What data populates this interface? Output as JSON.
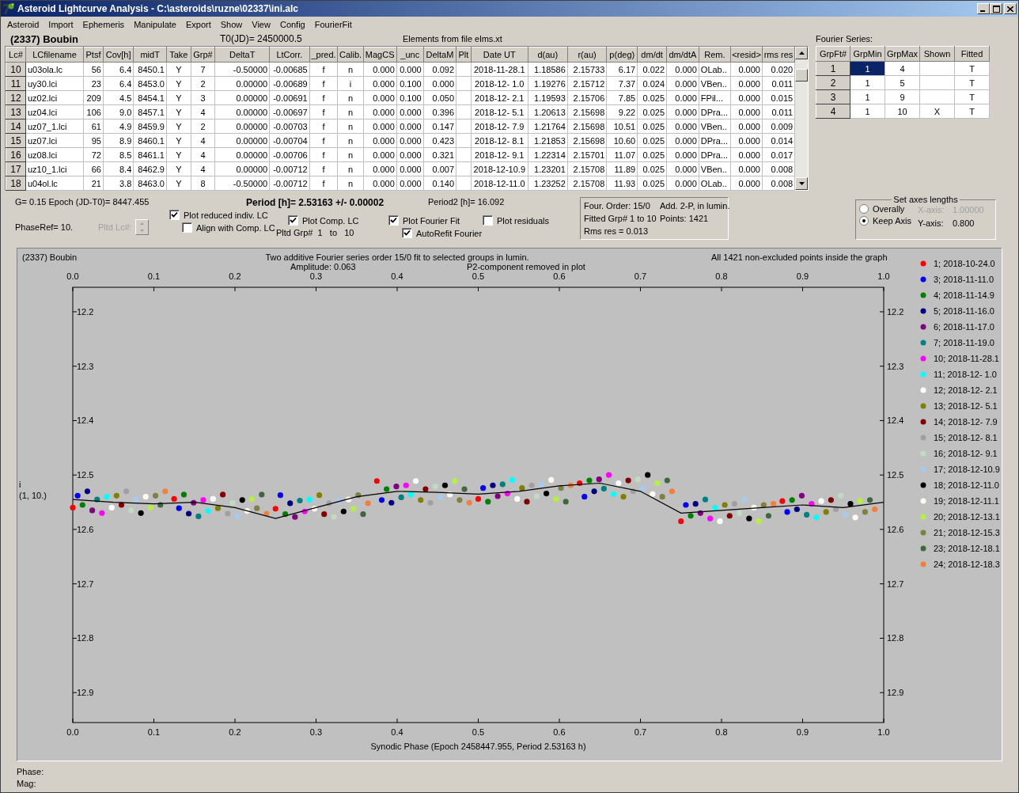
{
  "window": {
    "title": "Asteroid Lightcurve Analysis - C:\\asteroids\\ruzne\\02337\\ini.alc"
  },
  "menu": [
    "Asteroid",
    "Import",
    "Ephemeris",
    "Manipulate",
    "Export",
    "Show",
    "View",
    "Config",
    "FourierFit"
  ],
  "header": {
    "asteroid": "(2337) Boubin",
    "t0": "T0(JD)= 2450000.5",
    "elements": "Elements from file elms.xt"
  },
  "table": {
    "columns": [
      "Lc#",
      "LCfilename",
      "Ptsf",
      "Cov[h]",
      "midT",
      "Take",
      "Grp#",
      "DeltaT",
      "LtCorr.",
      "_pred.",
      "Calib.",
      "MagCS",
      "_unc",
      "DeltaM",
      "Plt",
      "Date UT",
      "d(au)",
      "r(au)",
      "p(deg)",
      "dm/dt",
      "dm/dtA",
      "Rem.",
      "<resid>",
      "rms res"
    ],
    "rows": [
      {
        "cells": [
          "10",
          "u03ola.lc",
          "56",
          "6.4",
          "8450.1",
          "Y",
          "7",
          "-0.50000",
          "-0.00685",
          "f",
          "n",
          "0.000",
          "0.000",
          "0.092",
          "",
          "2018-11-28.1",
          "1.18586",
          "2.15733",
          "6.17",
          "0.022",
          "0.000",
          "OLab..",
          "0.000",
          "0.020"
        ]
      },
      {
        "cells": [
          "11",
          "uy30.lci",
          "23",
          "6.4",
          "8453.0",
          "Y",
          "2",
          "0.00000",
          "-0.00689",
          "f",
          "i",
          "0.000",
          "0.100",
          "0.000",
          "",
          "2018-12- 1.0",
          "1.19276",
          "2.15712",
          "7.37",
          "0.024",
          "0.000",
          "VBen..",
          "0.000",
          "0.011"
        ]
      },
      {
        "cells": [
          "12",
          "uz02.lci",
          "209",
          "4.5",
          "8454.1",
          "Y",
          "3",
          "0.00000",
          "-0.00691",
          "f",
          "n",
          "0.000",
          "0.100",
          "0.050",
          "",
          "2018-12- 2.1",
          "1.19593",
          "2.15706",
          "7.85",
          "0.025",
          "0.000",
          "FPil...",
          "0.000",
          "0.015"
        ]
      },
      {
        "cells": [
          "13",
          "uz04.lci",
          "106",
          "9.0",
          "8457.1",
          "Y",
          "4",
          "0.00000",
          "-0.00697",
          "f",
          "n",
          "0.000",
          "0.000",
          "0.396",
          "",
          "2018-12- 5.1",
          "1.20613",
          "2.15698",
          "9.22",
          "0.025",
          "0.000",
          "DPra...",
          "0.000",
          "0.011"
        ]
      },
      {
        "cells": [
          "14",
          "uz07_1.lci",
          "61",
          "4.9",
          "8459.9",
          "Y",
          "2",
          "0.00000",
          "-0.00703",
          "f",
          "n",
          "0.000",
          "0.000",
          "0.147",
          "",
          "2018-12- 7.9",
          "1.21764",
          "2.15698",
          "10.51",
          "0.025",
          "0.000",
          "VBen..",
          "0.000",
          "0.009"
        ]
      },
      {
        "cells": [
          "15",
          "uz07.lci",
          "95",
          "8.9",
          "8460.1",
          "Y",
          "4",
          "0.00000",
          "-0.00704",
          "f",
          "n",
          "0.000",
          "0.000",
          "0.423",
          "",
          "2018-12- 8.1",
          "1.21853",
          "2.15698",
          "10.60",
          "0.025",
          "0.000",
          "DPra...",
          "0.000",
          "0.014"
        ]
      },
      {
        "cells": [
          "16",
          "uz08.lci",
          "72",
          "8.5",
          "8461.1",
          "Y",
          "4",
          "0.00000",
          "-0.00706",
          "f",
          "n",
          "0.000",
          "0.000",
          "0.321",
          "",
          "2018-12- 9.1",
          "1.22314",
          "2.15701",
          "11.07",
          "0.025",
          "0.000",
          "DPra...",
          "0.000",
          "0.017"
        ]
      },
      {
        "cells": [
          "17",
          "uz10_1.lci",
          "66",
          "8.4",
          "8462.9",
          "Y",
          "4",
          "0.00000",
          "-0.00712",
          "f",
          "n",
          "0.000",
          "0.000",
          "0.007",
          "",
          "2018-12-10.9",
          "1.23201",
          "2.15708",
          "11.89",
          "0.025",
          "0.000",
          "VBen..",
          "0.000",
          "0.008"
        ]
      },
      {
        "cells": [
          "18",
          "u04ol.lc",
          "21",
          "3.8",
          "8463.0",
          "Y",
          "8",
          "-0.50000",
          "-0.00712",
          "f",
          "n",
          "0.000",
          "0.000",
          "0.140",
          "",
          "2018-12-11.0",
          "1.23252",
          "2.15708",
          "11.93",
          "0.025",
          "0.000",
          "OLab..",
          "0.000",
          "0.008"
        ]
      }
    ]
  },
  "fourier_series": {
    "label": "Fourier Series:",
    "columns": [
      "GrpFt#",
      "GrpMin",
      "GrpMax",
      "Shown",
      "Fitted"
    ],
    "rows": [
      {
        "cells": [
          {
            "text": "1"
          },
          {
            "text": "1",
            "selected": true
          },
          {
            "text": "4",
            "selected": false
          },
          {
            "text": "",
            "selected": false
          },
          {
            "text": "T",
            "selected": false
          }
        ]
      },
      {
        "cells": [
          {
            "text": "2"
          },
          {
            "text": "1",
            "selected": false
          },
          {
            "text": "5",
            "selected": false
          },
          {
            "text": "",
            "selected": false
          },
          {
            "text": "T",
            "selected": false
          }
        ]
      },
      {
        "cells": [
          {
            "text": "3"
          },
          {
            "text": "1",
            "selected": false
          },
          {
            "text": "9",
            "selected": false
          },
          {
            "text": "",
            "selected": false
          },
          {
            "text": "T",
            "selected": false
          }
        ]
      },
      {
        "cells": [
          {
            "text": "4"
          },
          {
            "text": "1",
            "selected": false
          },
          {
            "text": "10",
            "selected": false
          },
          {
            "text": "X",
            "selected": false
          },
          {
            "text": "T",
            "selected": false
          }
        ]
      }
    ]
  },
  "info": {
    "g_epoch": "G= 0.15   Epoch (JD-T0)= 8447.455",
    "period": "Period [h]= 2.53163 +/- 0.00002",
    "period2": "Period2 [h]= 16.092",
    "phase_ref": "PhaseRef= 10.",
    "pltd_lc": "Pltd Lc#:",
    "pltd_grp": "Pltd Grp#  1   to   10"
  },
  "checkboxes": [
    {
      "label": "Plot reduced indiv. LC",
      "checked": true
    },
    {
      "label": "Align with Comp. LC",
      "checked": false
    },
    {
      "label": "Plot Comp. LC",
      "checked": true
    },
    {
      "label": "Plot Fourier Fit",
      "checked": true
    },
    {
      "label": "AutoRefit Fourier",
      "checked": true
    },
    {
      "label": "Plot residuals",
      "checked": false
    }
  ],
  "fit_summary": [
    "Four. Order: 15/0",
    "Add. 2-P, in lumin.",
    "Fitted Grp# 1 to 10",
    "Points: 1421",
    "Rms res     = 0.013"
  ],
  "axes_lengths": {
    "title": "Set axes lengths",
    "options": [
      {
        "label": "Overally",
        "selected": false
      },
      {
        "label": "Keep Axis",
        "selected": true
      }
    ],
    "x_label": "X-axis:",
    "x_value": "1.00000",
    "x_disabled": true,
    "y_label": "Y-axis:",
    "y_value": "0.800",
    "y_disabled": false
  },
  "chart": {
    "object": "(2337) Boubin",
    "title": "Two additive Fourier series order 15/0 fit to selected groups in lumin.",
    "amplitude": "Amplitude: 0.063",
    "p2_note": "P2-component removed in plot",
    "points_note": "All 1421 non-excluded points inside the graph",
    "ylabel_lines": [
      "i",
      "(1, 10.)"
    ],
    "right_ticks": [
      "12.2",
      "12.3",
      "12.4",
      "12.5",
      "12.6",
      "12.7",
      "12.8",
      "12.9"
    ],
    "chart_data": {
      "type": "scatter",
      "legend": "right",
      "xlabel": "Synodic Phase (Epoch 2458447.955, Period 2.53163 h)",
      "series": [
        {
          "type": "line",
          "color": "#000000",
          "x": [
            0,
            0.05,
            0.1,
            0.15,
            0.2,
            0.25,
            0.3,
            0.35,
            0.4,
            0.45,
            0.5,
            0.55,
            0.6,
            0.65,
            0.7,
            0.75,
            0.8,
            0.85,
            0.9,
            0.95,
            1
          ],
          "values": [
            12.545,
            12.55,
            12.553,
            12.55,
            12.56,
            12.58,
            12.56,
            12.54,
            12.53,
            12.532,
            12.535,
            12.53,
            12.52,
            12.515,
            12.53,
            12.57,
            12.565,
            12.56,
            12.555,
            12.56,
            12.55
          ]
        },
        {
          "name": "1; 2018-10-24.0",
          "color": "#ff0000",
          "x": [
            0,
            0.125,
            0.25,
            0.375,
            0.5,
            0.625,
            0.75,
            0.875
          ],
          "values": [
            12.56,
            12.544,
            12.562,
            12.511,
            12.544,
            12.515,
            12.585,
            12.548
          ]
        },
        {
          "name": "3; 2018-11-11.0",
          "color": "#0000ff",
          "x": [
            0.006,
            0.131,
            0.256,
            0.381,
            0.506,
            0.631,
            0.756,
            0.881
          ],
          "values": [
            12.538,
            12.561,
            12.537,
            12.546,
            12.524,
            12.54,
            12.555,
            12.568
          ]
        },
        {
          "name": "4; 2018-11-14.9",
          "color": "#008000",
          "x": [
            0.012,
            0.137,
            0.262,
            0.387,
            0.512,
            0.637,
            0.762,
            0.887
          ],
          "values": [
            12.555,
            12.536,
            12.572,
            12.526,
            12.549,
            12.51,
            12.575,
            12.546
          ]
        },
        {
          "name": "5; 2018-11-16.0",
          "color": "#000080",
          "x": [
            0.018,
            0.143,
            0.268,
            0.393,
            0.518,
            0.643,
            0.768,
            0.893
          ],
          "values": [
            12.53,
            12.571,
            12.552,
            12.551,
            12.519,
            12.53,
            12.553,
            12.563
          ]
        },
        {
          "name": "6; 2018-11-17.0",
          "color": "#800080",
          "x": [
            0.024,
            0.149,
            0.274,
            0.399,
            0.524,
            0.649,
            0.774,
            0.899
          ],
          "values": [
            12.565,
            12.551,
            12.577,
            12.521,
            12.539,
            12.508,
            12.57,
            12.538
          ]
        },
        {
          "name": "7; 2018-11-19.0",
          "color": "#008080",
          "x": [
            0.03,
            0.155,
            0.28,
            0.405,
            0.53,
            0.655,
            0.78,
            0.905
          ],
          "values": [
            12.545,
            12.576,
            12.547,
            12.541,
            12.517,
            12.525,
            12.545,
            12.573
          ]
        },
        {
          "name": "10; 2018-11-28.1",
          "color": "#ff00ff",
          "x": [
            0.036,
            0.161,
            0.286,
            0.411,
            0.536,
            0.661,
            0.786,
            0.911
          ],
          "values": [
            12.57,
            12.546,
            12.567,
            12.519,
            12.534,
            12.5,
            12.58,
            12.553
          ]
        },
        {
          "name": "11; 2018-12- 1.0",
          "color": "#00ffff",
          "x": [
            0.042,
            0.167,
            0.292,
            0.417,
            0.542,
            0.667,
            0.792,
            0.917
          ],
          "values": [
            12.54,
            12.566,
            12.545,
            12.536,
            12.509,
            12.535,
            12.56,
            12.578
          ]
        },
        {
          "name": "12; 2018-12- 2.1",
          "color": "#ffffff",
          "x": [
            0.048,
            0.173,
            0.298,
            0.423,
            0.548,
            0.673,
            0.798,
            0.923
          ],
          "values": [
            12.56,
            12.544,
            12.562,
            12.511,
            12.544,
            12.515,
            12.585,
            12.548
          ]
        },
        {
          "name": "13; 2018-12- 5.1",
          "color": "#808000",
          "x": [
            0.054,
            0.179,
            0.304,
            0.429,
            0.554,
            0.679,
            0.804,
            0.929
          ],
          "values": [
            12.538,
            12.561,
            12.537,
            12.546,
            12.524,
            12.54,
            12.555,
            12.568
          ]
        },
        {
          "name": "14; 2018-12- 7.9",
          "color": "#800000",
          "x": [
            0.06,
            0.185,
            0.31,
            0.435,
            0.56,
            0.685,
            0.81,
            0.935
          ],
          "values": [
            12.555,
            12.536,
            12.572,
            12.526,
            12.549,
            12.51,
            12.575,
            12.546
          ]
        },
        {
          "name": "15; 2018-12- 8.1",
          "color": "#a0a0a4",
          "x": [
            0.066,
            0.191,
            0.316,
            0.441,
            0.566,
            0.691,
            0.816,
            0.941
          ],
          "values": [
            12.53,
            12.571,
            12.552,
            12.551,
            12.519,
            12.53,
            12.553,
            12.563
          ]
        },
        {
          "name": "16; 2018-12- 9.1",
          "color": "#c0dcc0",
          "x": [
            0.072,
            0.197,
            0.322,
            0.447,
            0.572,
            0.697,
            0.822,
            0.947
          ],
          "values": [
            12.565,
            12.551,
            12.577,
            12.521,
            12.539,
            12.508,
            12.57,
            12.538
          ]
        },
        {
          "name": "17; 2018-12-10.9",
          "color": "#a6caf0",
          "x": [
            0.078,
            0.203,
            0.328,
            0.453,
            0.578,
            0.703,
            0.828,
            0.953
          ],
          "values": [
            12.545,
            12.576,
            12.547,
            12.541,
            12.517,
            12.525,
            12.545,
            12.573
          ]
        },
        {
          "name": "18; 2018-12-11.0",
          "color": "#000000",
          "x": [
            0.084,
            0.209,
            0.334,
            0.459,
            0.584,
            0.709,
            0.834,
            0.959
          ],
          "values": [
            12.57,
            12.546,
            12.567,
            12.519,
            12.534,
            12.5,
            12.58,
            12.553
          ]
        },
        {
          "name": "19; 2018-12-11.1",
          "color": "#fffbf0",
          "x": [
            0.09,
            0.215,
            0.34,
            0.465,
            0.59,
            0.715,
            0.84,
            0.965
          ],
          "values": [
            12.54,
            12.566,
            12.545,
            12.536,
            12.509,
            12.535,
            12.56,
            12.578
          ]
        },
        {
          "name": "20; 2018-12-13.1",
          "color": "#b4f040",
          "x": [
            0.096,
            0.221,
            0.346,
            0.471,
            0.596,
            0.721,
            0.846,
            0.971
          ],
          "values": [
            12.56,
            12.544,
            12.562,
            12.511,
            12.544,
            12.515,
            12.585,
            12.548
          ]
        },
        {
          "name": "21; 2018-12-15.3",
          "color": "#808040",
          "x": [
            0.102,
            0.227,
            0.352,
            0.477,
            0.602,
            0.727,
            0.852,
            0.977
          ],
          "values": [
            12.538,
            12.561,
            12.537,
            12.546,
            12.524,
            12.54,
            12.555,
            12.568
          ]
        },
        {
          "name": "23; 2018-12-18.1",
          "color": "#406840",
          "x": [
            0.108,
            0.233,
            0.358,
            0.483,
            0.608,
            0.733,
            0.858,
            0.983
          ],
          "values": [
            12.555,
            12.536,
            12.572,
            12.526,
            12.549,
            12.51,
            12.575,
            12.546
          ]
        },
        {
          "name": "24; 2018-12-18.3",
          "color": "#f08040",
          "x": [
            0.114,
            0.239,
            0.364,
            0.489,
            0.614,
            0.739,
            0.864,
            0.989
          ],
          "values": [
            12.53,
            12.571,
            12.552,
            12.551,
            12.519,
            12.53,
            12.553,
            12.563
          ]
        }
      ],
      "xlim": [
        0,
        1
      ],
      "ylim": [
        12.955,
        12.155
      ],
      "xticks": [
        {
          "value": 0,
          "label": "0.0"
        },
        {
          "value": 0.1,
          "label": "0.1"
        },
        {
          "value": 0.2,
          "label": "0.2"
        },
        {
          "value": 0.3,
          "label": "0.3"
        },
        {
          "value": 0.4,
          "label": "0.4"
        },
        {
          "value": 0.5,
          "label": "0.5"
        },
        {
          "value": 0.6,
          "label": "0.6"
        },
        {
          "value": 0.7,
          "label": "0.7"
        },
        {
          "value": 0.8,
          "label": "0.8"
        },
        {
          "value": 0.9,
          "label": "0.9"
        },
        {
          "value": 1,
          "label": "1.0"
        }
      ],
      "yticks": [
        12.2,
        12.3,
        12.4,
        12.5,
        12.6,
        12.7,
        12.8,
        12.9
      ]
    }
  },
  "status": {
    "phase": "Phase:",
    "mag": "Mag:"
  }
}
